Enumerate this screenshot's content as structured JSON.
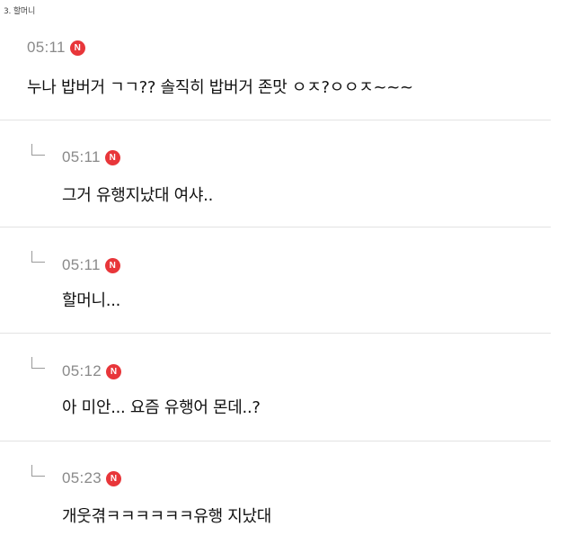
{
  "caption": "3. 할머니",
  "comments": [
    {
      "time": "05:11",
      "badge": "N",
      "text": "누나 밥버거 ㄱㄱ?? 솔직히 밥버거 존맛 ㅇㅈ?ㅇㅇㅈ~~~",
      "is_reply": false
    },
    {
      "time": "05:11",
      "badge": "N",
      "text": "그거 유행지났대 여샤..",
      "is_reply": true
    },
    {
      "time": "05:11",
      "badge": "N",
      "text": "할머니...",
      "is_reply": true
    },
    {
      "time": "05:12",
      "badge": "N",
      "text": "아 미안... 요즘 유행어 몬데..?",
      "is_reply": true
    },
    {
      "time": "05:23",
      "badge": "N",
      "text": "개웃겪ㅋㅋㅋㅋㅋㅋ유행 지났대",
      "is_reply": true
    }
  ],
  "colors": {
    "badge": "#e8363a",
    "time": "#8a8a8a",
    "divider": "#e3e3e3"
  }
}
